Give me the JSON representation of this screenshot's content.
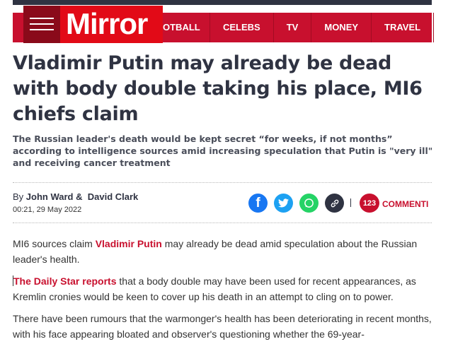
{
  "header": {
    "logo": "Mirror",
    "nav": [
      "OTBALL",
      "CELEBS",
      "TV",
      "MONEY",
      "TRAVEL"
    ]
  },
  "article": {
    "headline": "Vladimir Putin may already be dead with body double taking his place, MI6 chiefs claim",
    "standfirst": "The Russian leader's death would be kept secret “for weeks, if not months” according to intelligence sources amid increasing speculation that Putin is \"very ill\" and receiving cancer treatment",
    "byline_prefix": "By",
    "author1": "John Ward",
    "author_sep": " & ",
    "author2": "David Clark",
    "date": "00:21, 29 May 2022",
    "comments_count": "123",
    "comments_label": "COMMENTI",
    "paragraphs": [
      {
        "pre": "MI6 sources claim ",
        "link": "Vladimir Putin",
        "post": " may already be dead amid speculation about the Russian leader's health."
      },
      {
        "pre": "",
        "link": "The Daily Star reports",
        "post": " that a body double may have been used for recent appearances, as Kremlin cronies would be keen to cover up his death in an attempt to cling on to power."
      },
      {
        "pre": "There have been rumours that the warmonger's health has been deteriorating in recent months, with his face appearing bloated and observer's questioning whether the 69-year-",
        "link": "",
        "post": ""
      }
    ]
  },
  "share_icons": [
    "facebook-icon",
    "twitter-icon",
    "whatsapp-icon",
    "link-icon"
  ],
  "colors": {
    "brand": "#c8102e",
    "logo_bg": "#e20a17",
    "headline": "#2f3342"
  }
}
